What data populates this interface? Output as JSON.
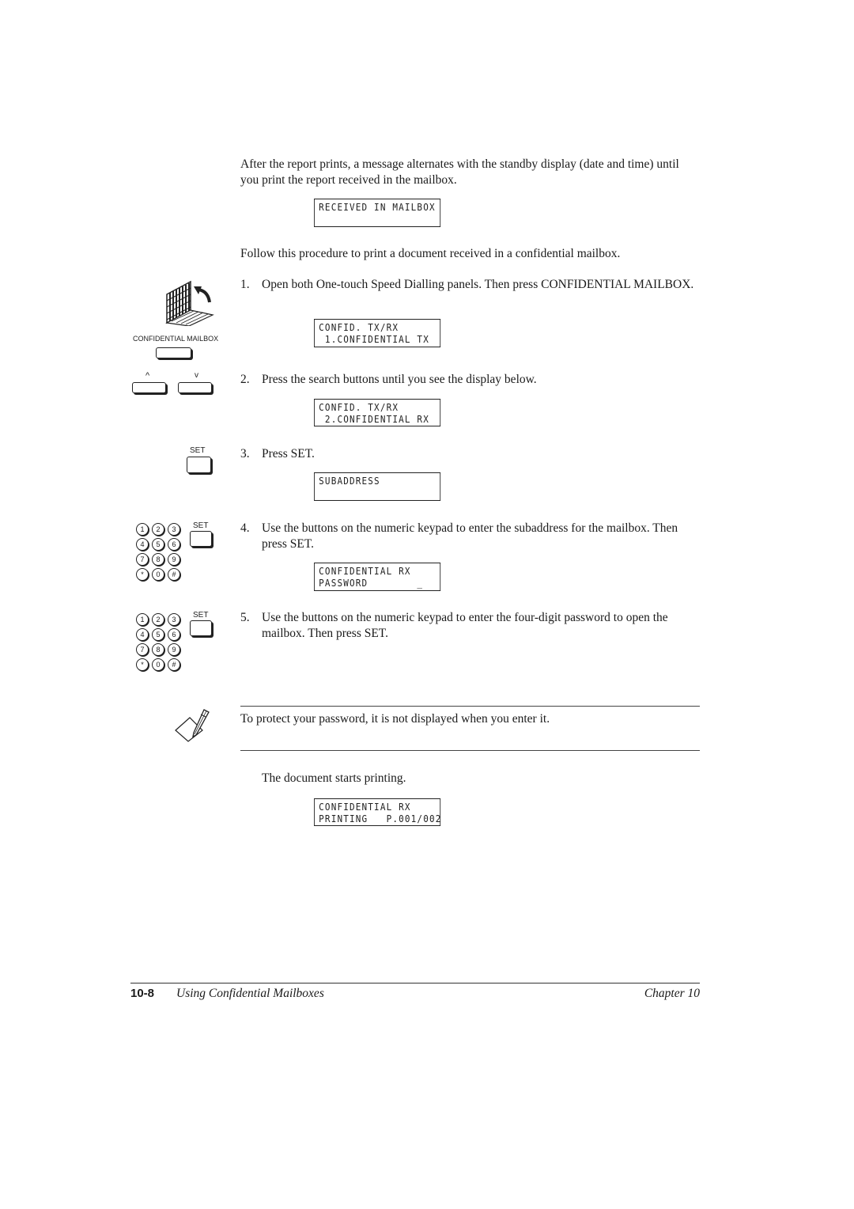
{
  "intro": {
    "text": "After the report prints, a message alternates with the standby display (date and time) until you print the report received in the mailbox.",
    "display": {
      "line1": "RECEIVED IN MAILBOX",
      "line2": ""
    }
  },
  "procedure_intro": "Follow this procedure to print a document received in a confidential mailbox.",
  "sidebar": {
    "confidential_mailbox_label": "CONFIDENTIAL MAILBOX",
    "search_up_label": "^",
    "search_down_label": "v",
    "set_label": "SET",
    "keypad_keys": [
      "1",
      "2",
      "3",
      "4",
      "5",
      "6",
      "7",
      "8",
      "9",
      "*",
      "0",
      "#"
    ]
  },
  "steps": [
    {
      "num": "1.",
      "text": "Open both One-touch Speed Dialling panels. Then press CONFIDENTIAL MAILBOX.",
      "display": {
        "line1": "CONFID. TX/RX",
        "line2": " 1.CONFIDENTIAL TX"
      }
    },
    {
      "num": "2.",
      "text": "Press the search buttons until you see the display below.",
      "display": {
        "line1": "CONFID. TX/RX",
        "line2": " 2.CONFIDENTIAL RX"
      }
    },
    {
      "num": "3.",
      "text": "Press SET.",
      "display": {
        "line1": "SUBADDRESS",
        "line2": ""
      }
    },
    {
      "num": "4.",
      "text": "Use the buttons on the numeric keypad to enter the subaddress for the mailbox. Then press SET.",
      "display": {
        "line1": "CONFIDENTIAL RX",
        "line2": "PASSWORD        _"
      }
    },
    {
      "num": "5.",
      "text": "Use the buttons on the numeric keypad to enter the four-digit password to open the mailbox. Then press SET."
    }
  ],
  "note": {
    "icon": "note-pencil-icon",
    "text": "To protect your password, it is not displayed when you enter it."
  },
  "result": {
    "text": "The document starts printing.",
    "display": {
      "line1": "CONFIDENTIAL RX",
      "line2": "PRINTING   P.001/002"
    }
  },
  "footer": {
    "page_number": "10-8",
    "section_title": "Using Confidential Mailboxes",
    "chapter": "Chapter 10"
  }
}
